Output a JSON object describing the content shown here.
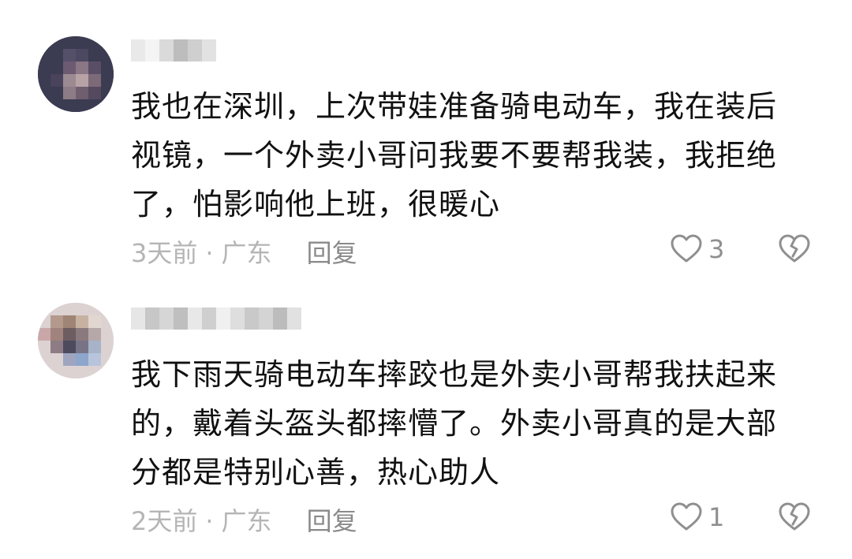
{
  "comments": [
    {
      "username": "",
      "content_lines": [
        "我也在深圳，上次带娃准备骑电动车，我在装后",
        "视镜，一个外卖小哥问我要不要帮我装，我拒绝",
        "了，怕影响他上班，很暖心"
      ],
      "time": "3天前",
      "separator": "·",
      "location": "广东",
      "reply_label": "回复",
      "like_count": "3",
      "like_icon": "heart-outline-icon",
      "dislike_icon": "broken-heart-icon"
    },
    {
      "username": "",
      "content_lines": [
        "我下雨天骑电动车摔跤也是外卖小哥帮我扶起来",
        "的，戴着头盔头都摔懵了。外卖小哥真的是大部",
        "分都是特别心善，热心助人"
      ],
      "time": "2天前",
      "separator": "·",
      "location": "广东",
      "reply_label": "回复",
      "like_count": "1",
      "like_icon": "heart-outline-icon",
      "dislike_icon": "broken-heart-icon"
    }
  ],
  "colors": {
    "text": "#111111",
    "meta": "#b5b5b5",
    "reply": "#8a8a8a",
    "icon": "#8f8f8f"
  }
}
